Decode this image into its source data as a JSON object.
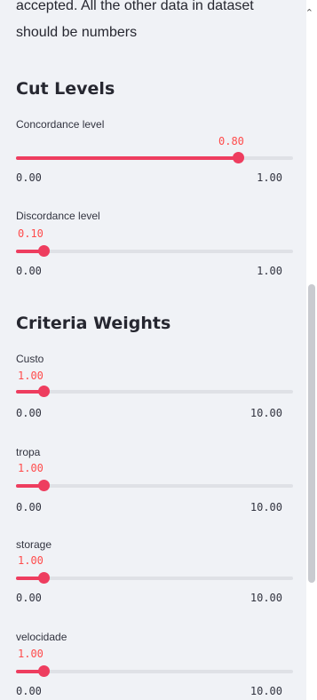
{
  "intro": {
    "line1": "accepted. All the other data in dataset",
    "line2": "should be numbers"
  },
  "cut_levels": {
    "title": "Cut Levels",
    "sliders": [
      {
        "label": "Concordance level",
        "value": "0.80",
        "min": "0.00",
        "max": "1.00",
        "fraction": 0.8
      },
      {
        "label": "Discordance level",
        "value": "0.10",
        "min": "0.00",
        "max": "1.00",
        "fraction": 0.1
      }
    ]
  },
  "criteria_weights": {
    "title": "Criteria Weights",
    "sliders": [
      {
        "label": "Custo",
        "value": "1.00",
        "min": "0.00",
        "max": "10.00",
        "fraction": 0.1
      },
      {
        "label": "tropa",
        "value": "1.00",
        "min": "0.00",
        "max": "10.00",
        "fraction": 0.1
      },
      {
        "label": "storage",
        "value": "1.00",
        "min": "0.00",
        "max": "10.00",
        "fraction": 0.1
      },
      {
        "label": "velocidade",
        "value": "1.00",
        "min": "0.00",
        "max": "10.00",
        "fraction": 0.1
      }
    ]
  },
  "colors": {
    "accent": "#ee3d5f",
    "value_text": "#ff4b4b",
    "track": "#dfe1e6"
  },
  "icons": {
    "collapse": "chevron-up-icon"
  }
}
